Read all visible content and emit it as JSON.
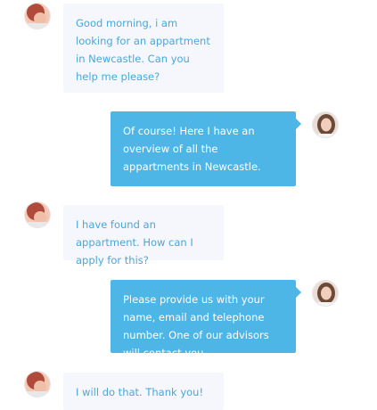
{
  "messages": [
    {
      "sender": "user",
      "text": "Good morning, i am looking for an appartment in Newcastle. Can you help me please?"
    },
    {
      "sender": "agent",
      "text": "Of course! Here I have an overview of all the appartments in Newcastle."
    },
    {
      "sender": "user",
      "text": "I have found an appartment. How can I apply for this?"
    },
    {
      "sender": "agent",
      "text": "Please provide us with your name, email and telephone number. One of our advisors will contact you."
    },
    {
      "sender": "user",
      "text": "I will do that. Thank you!"
    }
  ],
  "colors": {
    "user_bubble_bg": "#f6f7fd",
    "user_text": "#4aa7d8",
    "agent_bubble_bg": "#4db6e7",
    "agent_text": "#ffffff"
  }
}
